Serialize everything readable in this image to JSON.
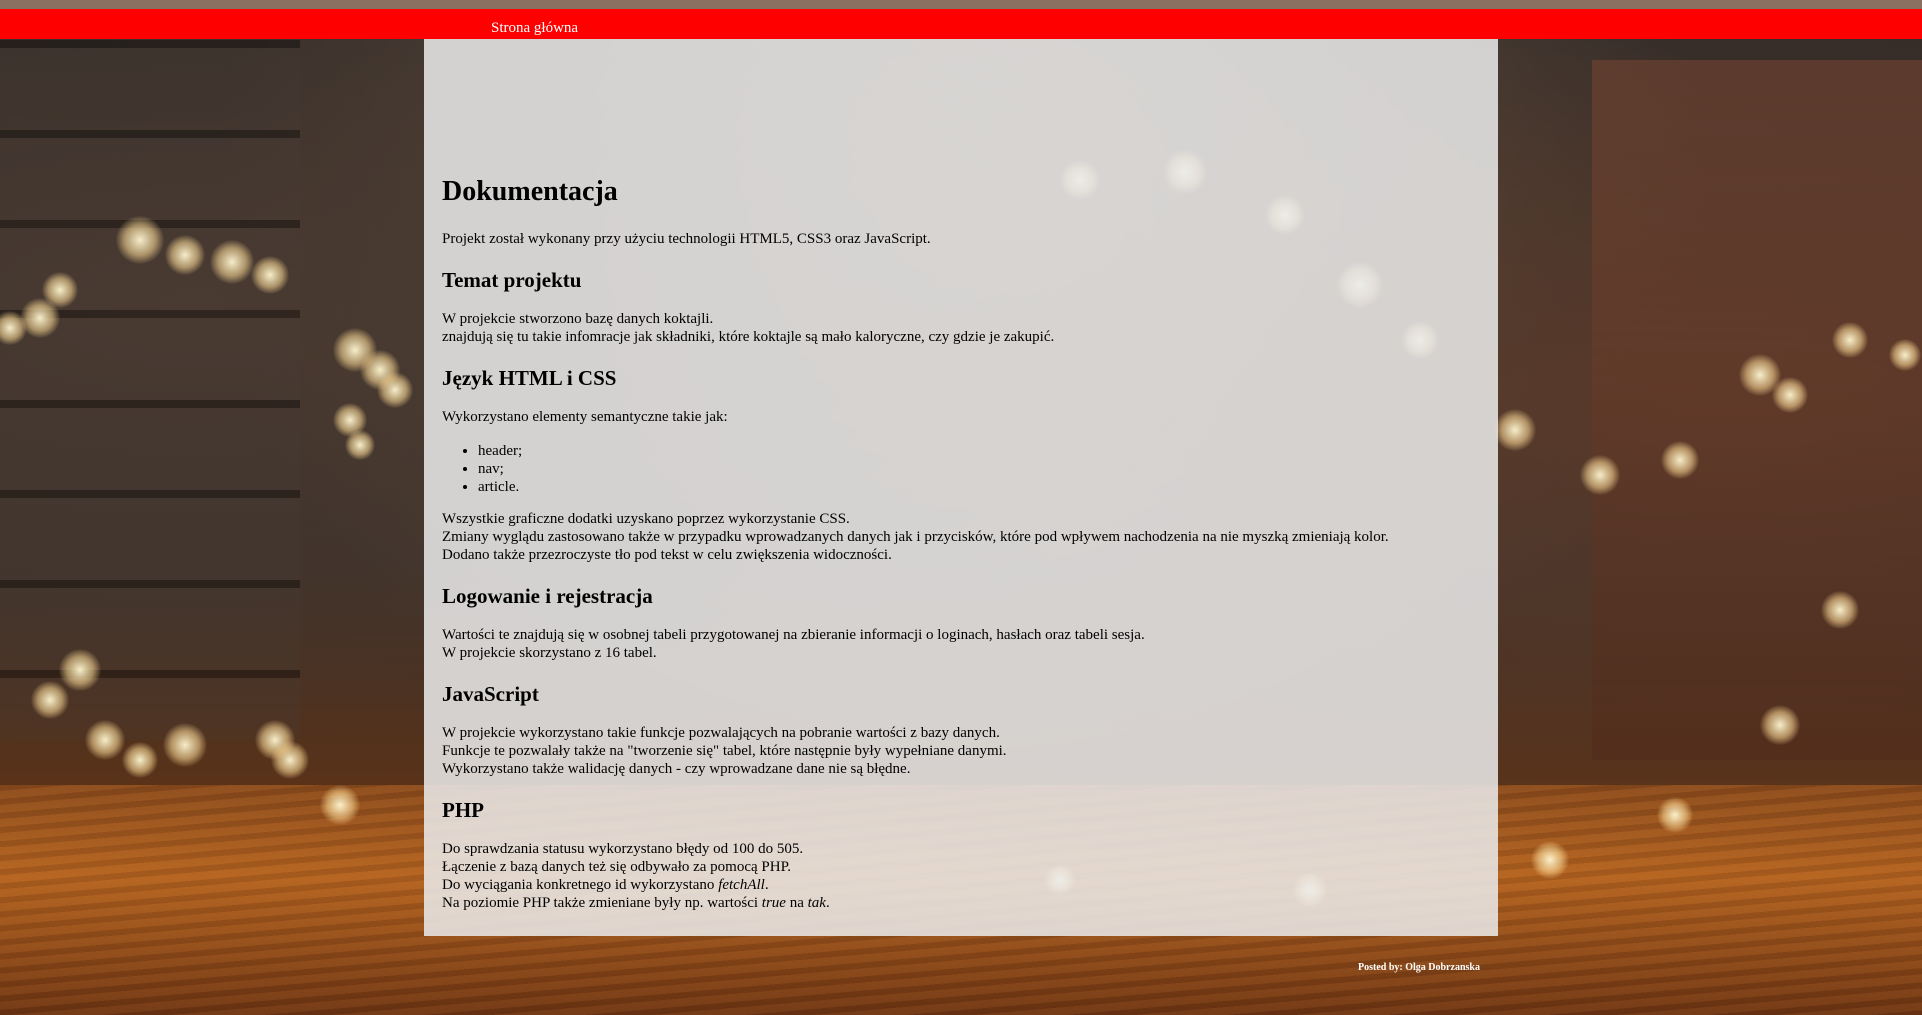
{
  "nav": {
    "home_label": "Strona główna"
  },
  "doc": {
    "title": "Dokumentacja",
    "intro": "Projekt został wykonany przy użyciu technologii HTML5, CSS3 oraz JavaScript.",
    "sections": {
      "topic": {
        "heading": "Temat projektu",
        "lines": [
          "W projekcie stworzono bazę danych koktajli.",
          "znajdują się tu takie infomracje jak składniki, które koktajle są mało kaloryczne, czy gdzie je zakupić."
        ]
      },
      "html_css": {
        "heading": "Język HTML i CSS",
        "intro": "Wykorzystano elementy semantyczne takie jak:",
        "list": [
          "header;",
          "nav;",
          "article."
        ],
        "lines": [
          "Wszystkie graficzne dodatki uzyskano poprzez wykorzystanie CSS.",
          "Zmiany wyglądu zastosowano także w przypadku wprowadzanych danych jak i przycisków, które pod wpływem nachodzenia na nie myszką zmieniają kolor.",
          "Dodano także przezroczyste tło pod tekst w celu zwiększenia widoczności."
        ]
      },
      "login": {
        "heading": "Logowanie i rejestracja",
        "lines": [
          "Wartości te znajdują się w osobnej tabeli przygotowanej na zbieranie informacji o loginach, hasłach oraz tabeli sesja.",
          "W projekcie skorzystano z 16 tabel."
        ]
      },
      "js": {
        "heading": "JavaScript",
        "lines": [
          "W projekcie wykorzystano takie funkcje pozwalających na pobranie wartości z bazy danych.",
          "Funkcje te pozwalały także na \"tworzenie się\" tabel, które następnie były wypełniane danymi.",
          "Wykorzystano także walidację danych - czy wprowadzane dane nie są błędne."
        ]
      },
      "php": {
        "heading": "PHP",
        "line1": "Do sprawdzania statusu wykorzystano błędy od 100 do 505.",
        "line2": "Łączenie z bazą danych też się odbywało za pomocą PHP.",
        "line3_prefix": "Do wyciągania konkretnego id wykorzystano ",
        "line3_em": "fetchAll",
        "line3_suffix": ".",
        "line4_prefix": "Na poziomie PHP także zmieniane były np. wartości ",
        "line4_em1": "true",
        "line4_mid": " na ",
        "line4_em2": "tak",
        "line4_suffix": "."
      }
    }
  },
  "footer": {
    "text": "Posted by: Olga Dobrzanska"
  },
  "colors": {
    "navbar": "#ff0000",
    "panel": "rgba(235,235,235,0.86)"
  }
}
